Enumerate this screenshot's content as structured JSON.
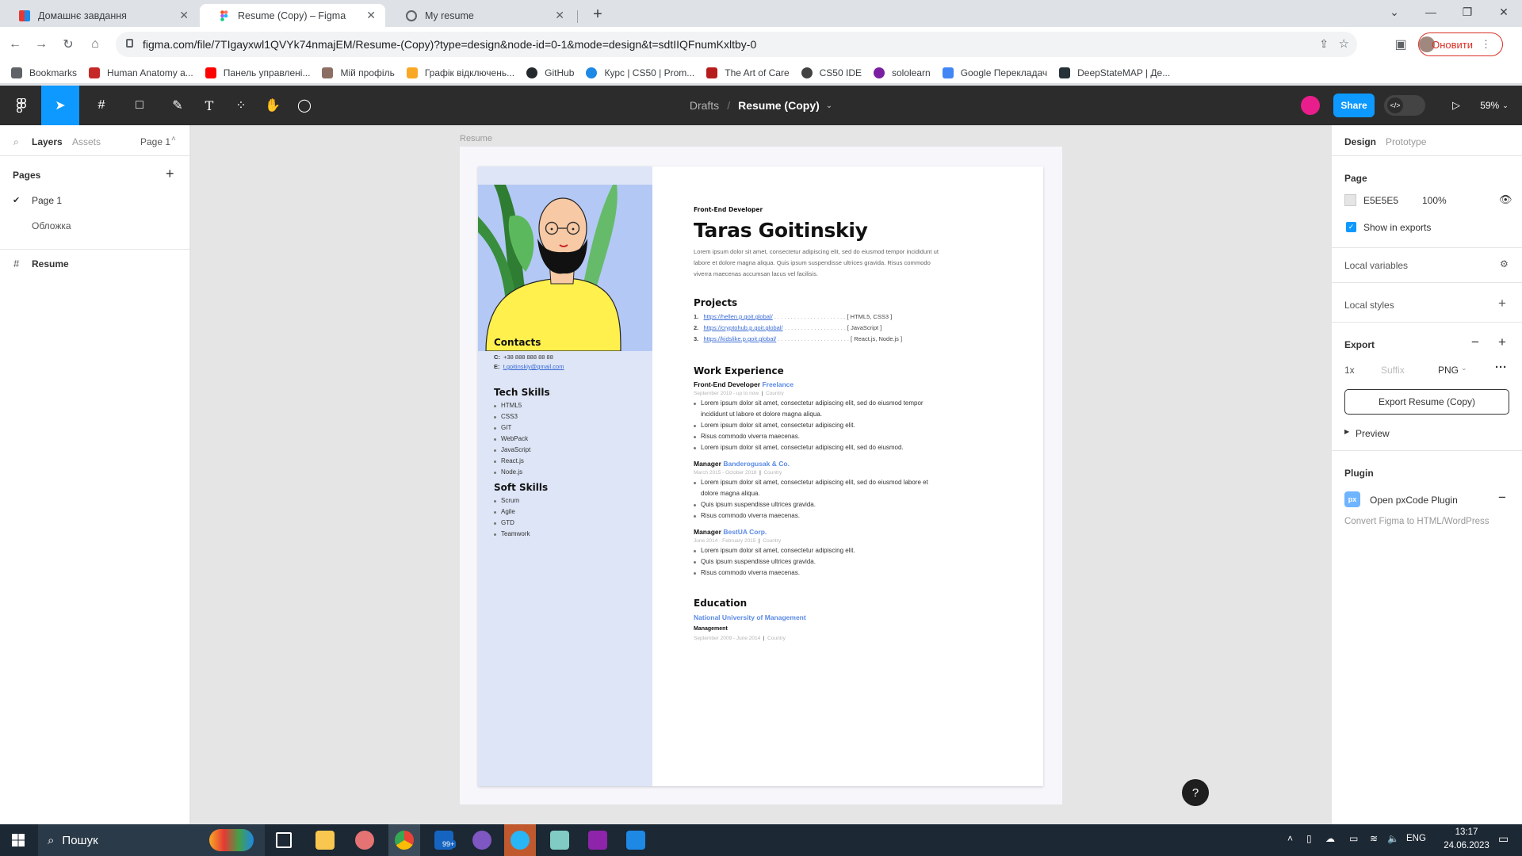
{
  "browser": {
    "tabs": [
      {
        "title": "Домашнє завдання",
        "active": false
      },
      {
        "title": "Resume (Copy) – Figma",
        "active": true
      },
      {
        "title": "My resume",
        "active": false
      }
    ],
    "new_tab": "+",
    "url": "figma.com/file/7TIgayxwl1QVYk74nmajEM/Resume-(Copy)?type=design&node-id=0-1&mode=design&t=sdtIIQFnumKxltby-0",
    "update_label": "Оновити"
  },
  "bookmarks": [
    {
      "label": "Bookmarks",
      "color": "#5f6368"
    },
    {
      "label": "Human Anatomy a...",
      "color": "#c62828"
    },
    {
      "label": "Панель управлені...",
      "color": "#ff0000"
    },
    {
      "label": "Мій профіль",
      "color": "#8d6e63"
    },
    {
      "label": "Графік відключень...",
      "color": "#f9a825"
    },
    {
      "label": "GitHub",
      "color": "#24292e"
    },
    {
      "label": "Курс | CS50 | Prom...",
      "color": "#1e88e5"
    },
    {
      "label": "The Art of Care",
      "color": "#b71c1c"
    },
    {
      "label": "CS50 IDE",
      "color": "#424242"
    },
    {
      "label": "sololearn",
      "color": "#7b1fa2"
    },
    {
      "label": "Google Перекладач",
      "color": "#4285f4"
    },
    {
      "label": "DeepStateMAP | Де...",
      "color": "#263238"
    }
  ],
  "figma": {
    "breadcrumb_root": "Drafts",
    "breadcrumb_sep": "/",
    "file_name": "Resume (Copy)",
    "share_label": "Share",
    "zoom": "59%"
  },
  "left_panel": {
    "tabs": [
      "Layers",
      "Assets"
    ],
    "page_selector": "Page 1",
    "pages_heading": "Pages",
    "pages": [
      "Page 1",
      "Обложка"
    ],
    "layers": [
      "Resume"
    ]
  },
  "canvas": {
    "frame_label": "Resume"
  },
  "resume": {
    "role": "Front-End Developer",
    "name": "Taras Goitinskiy",
    "intro": "Lorem ipsum dolor sit amet, consectetur adipiscing elit, sed do eiusmod tempor incididunt ut labore et dolore magna aliqua. Quis ipsum suspendisse ultrices gravida. Risus commodo viverra maecenas accumsan lacus vel facilisis.",
    "contacts_title": "Contacts",
    "phone_label": "C:",
    "phone": "+38 888 888 88 88",
    "email_label": "E:",
    "email": "t.goitinskiy@gmail.com",
    "tech_title": "Tech Skills",
    "tech_skills": [
      "HTML5",
      "CSS3",
      "GIT",
      "WebPack",
      "JavaScript",
      "React.js",
      "Node.js"
    ],
    "soft_title": "Soft Skills",
    "soft_skills": [
      "Scrum",
      "Agile",
      "GTD",
      "Teamwork"
    ],
    "projects_title": "Projects",
    "projects": [
      {
        "num": "1.",
        "url": "https://hellen.p.goit.global/",
        "dots": ". . . . . . . . . . . . . . . . . . . . . .",
        "tech": "[ HTML5, CSS3 ]"
      },
      {
        "num": "2.",
        "url": "https://cryptohub.p.goit.global/",
        "dots": ". . . . . . . . . . . . . . . . . . .",
        "tech": "[ JavaScript ]"
      },
      {
        "num": "3.",
        "url": "https://kidslike.p.goit.global/",
        "dots": ". . . . . . . . . . . . . . . . . . . . . .",
        "tech": "[ React.js, Node.js ]"
      }
    ],
    "work_title": "Work Experience",
    "jobs": [
      {
        "position": "Front-End Developer",
        "company": "Freelance",
        "dates": "September 2019 - up to now",
        "sep": "|",
        "place": "Country",
        "bullets": [
          "Lorem ipsum dolor sit amet, consectetur adipiscing elit, sed do eiusmod tempor incididunt ut labore et dolore magna aliqua.",
          "Lorem ipsum dolor sit amet, consectetur adipiscing elit.",
          "Risus commodo viverra maecenas.",
          "Lorem ipsum dolor sit amet, consectetur adipiscing elit, sed do eiusmod."
        ]
      },
      {
        "position": "Manager",
        "company": "Banderogusak & Co.",
        "dates": "March 2015 - October 2018",
        "sep": "|",
        "place": "Country",
        "bullets": [
          "Lorem ipsum dolor sit amet, consectetur adipiscing elit, sed do eiusmod labore et dolore magna aliqua.",
          "Quis ipsum suspendisse ultrices gravida.",
          "Risus commodo viverra maecenas."
        ]
      },
      {
        "position": "Manager",
        "company": "BestUA Corp.",
        "dates": "June 2014 - February 2015",
        "sep": "|",
        "place": "Country",
        "bullets": [
          "Lorem ipsum dolor sit amet, consectetur adipiscing elit.",
          "Quis ipsum suspendisse ultrices gravida.",
          "Risus commodo viverra maecenas."
        ]
      }
    ],
    "education_title": "Education",
    "university": "National University of Management",
    "degree": "Management",
    "edu_dates": "September 2009 - June 2014",
    "edu_sep": "|",
    "edu_place": "Country"
  },
  "right_panel": {
    "tabs": [
      "Design",
      "Prototype"
    ],
    "page_title": "Page",
    "page_color": "E5E5E5",
    "page_opacity": "100%",
    "show_in_exports": "Show in exports",
    "local_variables": "Local variables",
    "local_styles": "Local styles",
    "export_title": "Export",
    "export_scale": "1x",
    "export_suffix_placeholder": "Suffix",
    "export_format": "PNG",
    "export_button": "Export Resume (Copy)",
    "preview": "Preview",
    "plugin_title": "Plugin",
    "plugin_name": "Open pxCode Plugin",
    "plugin_desc": "Convert Figma to HTML/WordPress",
    "help": "?"
  },
  "taskbar": {
    "search": "Пошук",
    "lang": "ENG",
    "time": "13:17",
    "date": "24.06.2023",
    "mail_badge": "99+"
  }
}
